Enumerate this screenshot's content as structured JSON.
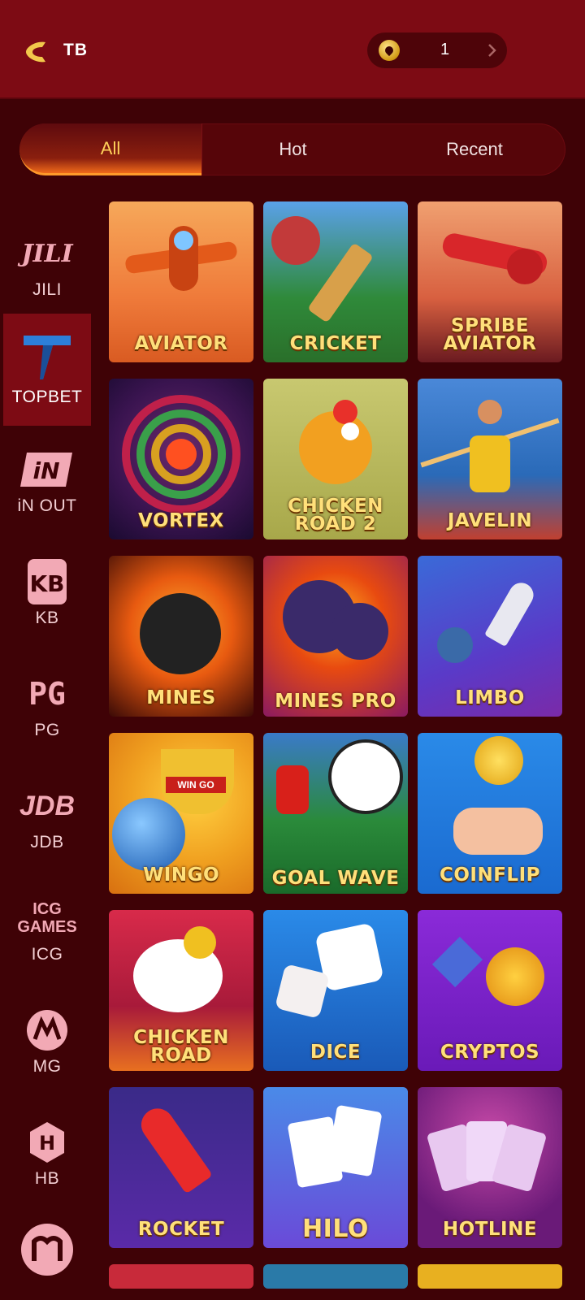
{
  "header": {
    "title": "TB",
    "balance": "1"
  },
  "tabs": [
    {
      "label": "All",
      "active": true
    },
    {
      "label": "Hot"
    },
    {
      "label": "Recent"
    }
  ],
  "providers": [
    {
      "logo": "JILI",
      "label": "JILI"
    },
    {
      "logo": "T",
      "label": "TOPBET",
      "active": true
    },
    {
      "logo": "iN",
      "label": "iN OUT"
    },
    {
      "logo": "KB",
      "label": "KB"
    },
    {
      "logo": "PG",
      "label": "PG"
    },
    {
      "logo": "JDB",
      "label": "JDB"
    },
    {
      "logo": "ICG GAMES",
      "label": "ICG"
    },
    {
      "logo": "M",
      "label": "MG"
    },
    {
      "logo": "H",
      "label": "HB"
    }
  ],
  "games": [
    {
      "name": "AVIATOR"
    },
    {
      "name": "CRICKET"
    },
    {
      "name": "SPRIBE AVIATOR"
    },
    {
      "name": "VORTEX"
    },
    {
      "name": "CHICKEN ROAD 2"
    },
    {
      "name": "JAVELIN"
    },
    {
      "name": "MINES"
    },
    {
      "name": "MINES PRO"
    },
    {
      "name": "LIMBO"
    },
    {
      "name": "WINGO",
      "badge": "WIN GO"
    },
    {
      "name": "GOAL WAVE"
    },
    {
      "name": "COINFLIP"
    },
    {
      "name": "CHICKEN ROAD"
    },
    {
      "name": "DICE"
    },
    {
      "name": "CRYPTOS"
    },
    {
      "name": "ROCKET"
    },
    {
      "name": "HILO"
    },
    {
      "name": "HOTLINE"
    }
  ],
  "colors": {
    "header": "#7d0b14",
    "background": "#3f0206",
    "accent": "#ffd15a"
  }
}
